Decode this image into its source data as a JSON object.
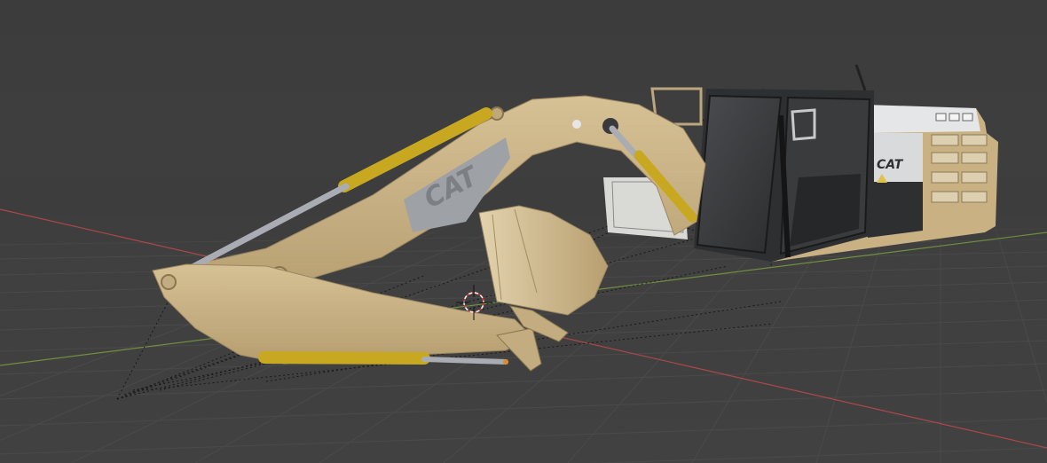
{
  "viewport": {
    "view": "3D viewport",
    "grid_visible": true,
    "axis_colors": {
      "x_axis": "#c84a4a",
      "y_axis": "#7ba23f"
    },
    "background": "#3d3d3d"
  },
  "model": {
    "name_text": "CAT",
    "body_color": "#c9b184",
    "cylinder_color": "#c9a821",
    "rod_color": "#a9adb3",
    "cab_color": "#2e2f31",
    "logo_panel_color": "#9ea1a6"
  },
  "cursor": {
    "icon": "3d-cursor-icon"
  }
}
